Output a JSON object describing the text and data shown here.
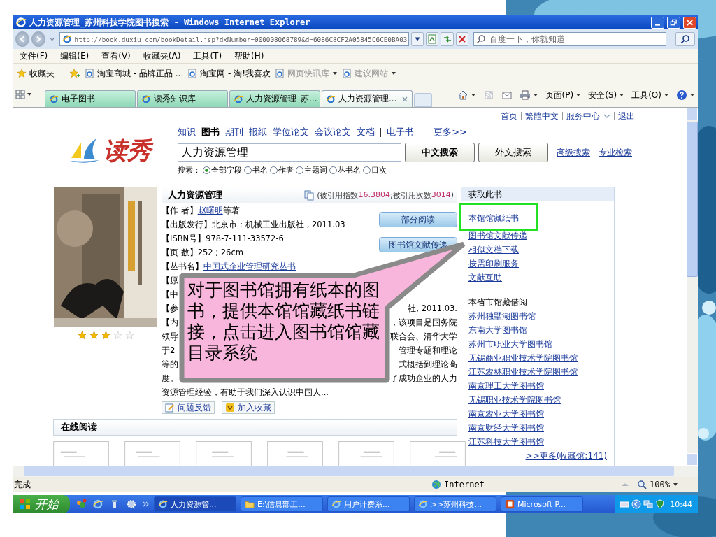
{
  "window": {
    "title": "人力资源管理_苏州科技学院图书搜索 - Windows Internet Explorer"
  },
  "address_bar": {
    "url": "http://book.duxiu.com/bookDetail.jsp?dxNumber=000008068789&d=6086C8CF2A05845C6CE0BA03"
  },
  "search_field": {
    "placeholder": "百度一下，你就知道"
  },
  "menu": [
    "文件(F)",
    "编辑(E)",
    "查看(V)",
    "收藏夹(A)",
    "工具(T)",
    "帮助(H)"
  ],
  "favorites_bar": {
    "label": "收藏夹",
    "items": [
      {
        "label": "淘宝商城 - 品牌正品 ...",
        "disabled": false,
        "dropdown": false
      },
      {
        "label": "淘宝网 - 淘!我喜欢",
        "disabled": false,
        "dropdown": false
      },
      {
        "label": "网页快讯库",
        "disabled": true,
        "dropdown": true
      },
      {
        "label": "建议网站",
        "disabled": true,
        "dropdown": true
      }
    ]
  },
  "tabs": [
    {
      "label": "电子图书",
      "selected": false
    },
    {
      "label": "读秀知识库",
      "selected": false
    },
    {
      "label": "人力资源管理_苏...",
      "selected": false
    },
    {
      "label": "人力资源管理...",
      "selected": true
    }
  ],
  "command_bar": [
    "页面(P)",
    "安全(S)",
    "工具(O)"
  ],
  "page": {
    "top_links": [
      "首页",
      "繁體中文",
      "服务中心",
      "退出"
    ],
    "logo": "读秀",
    "categories": [
      {
        "label": "知识",
        "selected": false
      },
      {
        "label": "图书",
        "selected": true
      },
      {
        "label": "期刊",
        "selected": false
      },
      {
        "label": "报纸",
        "selected": false
      },
      {
        "label": "学位论文",
        "selected": false
      },
      {
        "label": "会议论文",
        "selected": false
      },
      {
        "label": "文档",
        "selected": false
      },
      {
        "label": "电子书",
        "selected": false
      }
    ],
    "more": "更多>>",
    "query": "人力资源管理",
    "search_buttons": [
      "中文搜索",
      "外文搜索"
    ],
    "search_links": [
      "高级搜索",
      "专业检索"
    ],
    "scope_label": "搜索：",
    "scopes": [
      {
        "label": "全部字段",
        "selected": true
      },
      {
        "label": "书名",
        "selected": false
      },
      {
        "label": "作者",
        "selected": false
      },
      {
        "label": "主题词",
        "selected": false
      },
      {
        "label": "丛书名",
        "selected": false
      },
      {
        "label": "目次",
        "selected": false
      }
    ],
    "book": {
      "title": "人力资源管理",
      "citation": [
        {
          "text": "(被引用指数",
          "highlight": false
        },
        {
          "text": "16.3804",
          "highlight": true
        },
        {
          "text": ";被引用次数",
          "highlight": false
        },
        {
          "text": "3014",
          "highlight": true
        },
        {
          "text": ")",
          "highlight": false
        }
      ],
      "fields": [
        {
          "label": "【作 者】",
          "value": "赵曙明",
          "kind": "link",
          "suffix": "等著"
        },
        {
          "label": "【出版发行】",
          "value": "北京市：机械工业出版社 , 2011.03",
          "kind": "text"
        },
        {
          "label": "【ISBN号】",
          "value": "978-7-111-33572-6",
          "kind": "text"
        },
        {
          "label": "【页 数】",
          "value": "252 ; 26cm",
          "kind": "text"
        },
        {
          "label": "【丛书名】",
          "value": "中国式企业管理研究丛书",
          "kind": "link"
        }
      ],
      "action_buttons": [
        "部分阅读",
        "图书馆文献传递"
      ],
      "covered_lines": [
        {
          "left": "【原"
        },
        {
          "left": "【中"
        },
        {
          "left": "【参",
          "right": "社, 2011.03."
        },
        {
          "left": "【内",
          "right": "，该项目是国务院"
        },
        {
          "left": "领导",
          "right": "联合会、清华大学"
        },
        {
          "left": "于2",
          "right": "管理专题和理论"
        },
        {
          "left": "等的",
          "right": "式概括到理论高"
        },
        {
          "left": "度。",
          "right": "了成功企业的人力"
        }
      ],
      "summary_end": "资源管理经验，有助于我们深入认识中国人...",
      "tools": [
        "问题反馈",
        "加入收藏"
      ],
      "stars": 3
    },
    "online_reading": {
      "title": "在线阅读",
      "thumbnails": [
        {
          "kind": "page"
        },
        {
          "kind": "page"
        },
        {
          "kind": "page"
        },
        {
          "kind": "page"
        },
        {
          "kind": "page"
        },
        {
          "kind": "page"
        }
      ]
    },
    "sidebar": {
      "title": "获取此书",
      "links": [
        "本馆馆藏纸书",
        "图书馆文献传递",
        "相似文档下载",
        "按需印刷服务",
        "文献互助"
      ],
      "section": "本省市馆藏借阅",
      "libraries": [
        "苏州独墅湖图书馆",
        "东南大学图书馆",
        "苏州市职业大学图书馆",
        "无锡商业职业技术学院图书馆",
        "江苏农林职业技术学院图书馆",
        "南京理工大学图书馆",
        "无锡职业技术学院图书馆",
        "南京农业大学图书馆",
        "南京财经大学图书馆",
        "江苏科技大学图书馆"
      ],
      "more": ">>更多(收藏馆:141)"
    }
  },
  "callout": {
    "text": "对于图书馆拥有纸本的图书，提供本馆馆藏纸书链接，点击进入图书馆馆藏目录系统"
  },
  "status_bar": {
    "text": "完成",
    "zone": "Internet",
    "zoom": "100%"
  },
  "taskbar": {
    "start": "开始",
    "items": [
      {
        "label": "人力资源管...",
        "kind": "ie",
        "selected": true
      },
      {
        "label": "E:\\信息部工...",
        "kind": "folder",
        "selected": false
      },
      {
        "label": "用户计费系...",
        "kind": "ie",
        "selected": false
      },
      {
        "label": ">>苏州科技...",
        "kind": "ie",
        "selected": false
      },
      {
        "label": "Microsoft P...",
        "kind": "ppt",
        "selected": false
      }
    ],
    "clock": "10:44"
  }
}
